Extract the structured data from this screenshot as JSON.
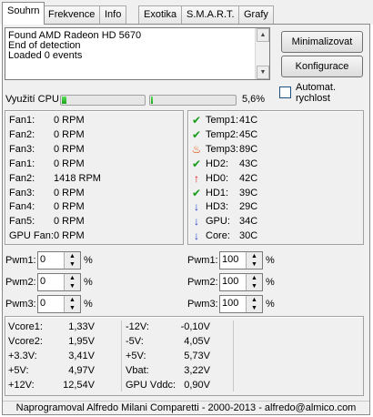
{
  "tabs": [
    {
      "label": "Souhrn",
      "active": true
    },
    {
      "label": "Frekvence",
      "active": false
    },
    {
      "label": "Info",
      "active": false
    },
    {
      "label": "Exotika",
      "active": false
    },
    {
      "label": "S.M.A.R.T.",
      "active": false
    },
    {
      "label": "Grafy",
      "active": false
    }
  ],
  "log": {
    "lines": [
      "Found AMD Radeon HD 5670",
      "End of detection",
      "Loaded 0 events"
    ]
  },
  "buttons": {
    "minimize": "Minimalizovat",
    "config": "Konfigurace"
  },
  "auto_speed": {
    "label_line1": "Automat.",
    "label_line2": "rychlost",
    "checked": false
  },
  "cpu": {
    "label": "Využití CPU",
    "value": "5,6%",
    "bar1_fraction": 0.05,
    "bar2_fraction": 0.02
  },
  "fans": [
    {
      "name": "Fan1:",
      "value": "0 RPM"
    },
    {
      "name": "Fan2:",
      "value": "0 RPM"
    },
    {
      "name": "Fan3:",
      "value": "0 RPM"
    },
    {
      "name": "Fan1:",
      "value": "0 RPM"
    },
    {
      "name": "Fan2:",
      "value": "1418 RPM"
    },
    {
      "name": "Fan3:",
      "value": "0 RPM"
    },
    {
      "name": "Fan4:",
      "value": "0 RPM"
    },
    {
      "name": "Fan5:",
      "value": "0 RPM"
    },
    {
      "name": "GPU Fan:",
      "value": "0 RPM"
    }
  ],
  "temps": [
    {
      "name": "Temp1:",
      "value": "41C",
      "icon": "check-icon",
      "color": "#1a9a1a"
    },
    {
      "name": "Temp2:",
      "value": "45C",
      "icon": "check-icon",
      "color": "#1a9a1a"
    },
    {
      "name": "Temp3:",
      "value": "89C",
      "icon": "flame-icon",
      "color": "#e04a00"
    },
    {
      "name": "HD2:",
      "value": "43C",
      "icon": "check-icon",
      "color": "#1a9a1a"
    },
    {
      "name": "HD0:",
      "value": "42C",
      "icon": "arrow-up-icon",
      "color": "#e01010"
    },
    {
      "name": "HD1:",
      "value": "39C",
      "icon": "check-icon",
      "color": "#1a9a1a"
    },
    {
      "name": "HD3:",
      "value": "29C",
      "icon": "arrow-down-icon",
      "color": "#1a3ad0"
    },
    {
      "name": "GPU:",
      "value": "34C",
      "icon": "arrow-down-icon",
      "color": "#1a3ad0"
    },
    {
      "name": "Core:",
      "value": "30C",
      "icon": "arrow-down-icon",
      "color": "#1a3ad0"
    }
  ],
  "pwm_left": [
    {
      "label": "Pwm1:",
      "value": "0",
      "unit": "%"
    },
    {
      "label": "Pwm2:",
      "value": "0",
      "unit": "%"
    },
    {
      "label": "Pwm3:",
      "value": "0",
      "unit": "%"
    }
  ],
  "pwm_right": [
    {
      "label": "Pwm1:",
      "value": "100",
      "unit": "%"
    },
    {
      "label": "Pwm2:",
      "value": "100",
      "unit": "%"
    },
    {
      "label": "Pwm3:",
      "value": "100",
      "unit": "%"
    }
  ],
  "voltages_left": [
    {
      "name": "Vcore1:",
      "value": "1,33V"
    },
    {
      "name": "Vcore2:",
      "value": "1,95V"
    },
    {
      "name": "+3.3V:",
      "value": "3,41V"
    },
    {
      "name": "+5V:",
      "value": "4,97V"
    },
    {
      "name": "+12V:",
      "value": "12,54V"
    }
  ],
  "voltages_right": [
    {
      "name": "-12V:",
      "value": "-0,10V"
    },
    {
      "name": "-5V:",
      "value": "4,05V"
    },
    {
      "name": "+5V:",
      "value": "5,73V"
    },
    {
      "name": "Vbat:",
      "value": "3,22V"
    },
    {
      "name": "GPU Vddc:",
      "value": "0,90V"
    }
  ],
  "footer": "Naprogramoval Alfredo Milani Comparetti - 2000-2013 - alfredo@almico.com"
}
